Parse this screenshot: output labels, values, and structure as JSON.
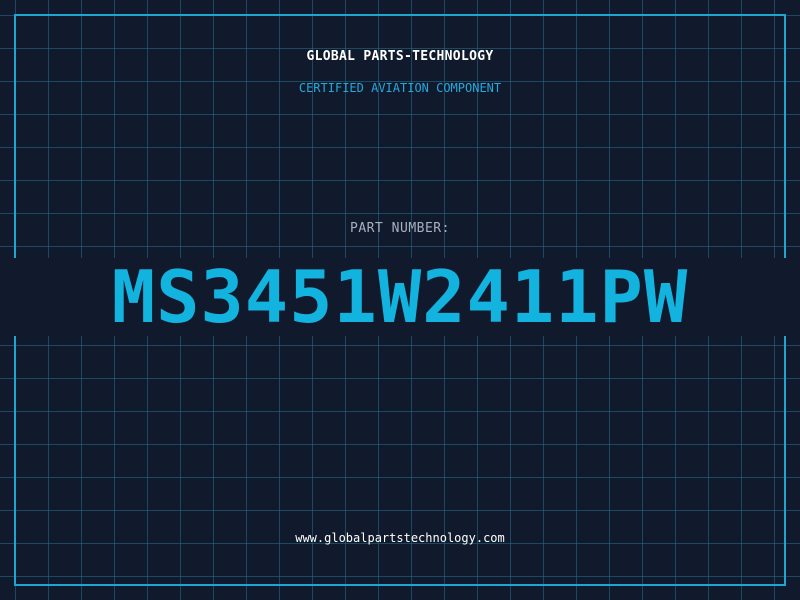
{
  "header": {
    "brand": "GLOBAL PARTS-TECHNOLOGY",
    "tagline": "CERTIFIED AVIATION COMPONENT"
  },
  "part": {
    "label": "PART NUMBER:",
    "number": "MS3451W2411PW"
  },
  "footer": {
    "website": "www.globalpartstechnology.com"
  },
  "colors": {
    "background": "#111a2d",
    "grid": "#266e8c",
    "frame": "#1fa6d0",
    "accent": "#12b3de",
    "label": "#a6b0be",
    "text": "#ffffff"
  }
}
